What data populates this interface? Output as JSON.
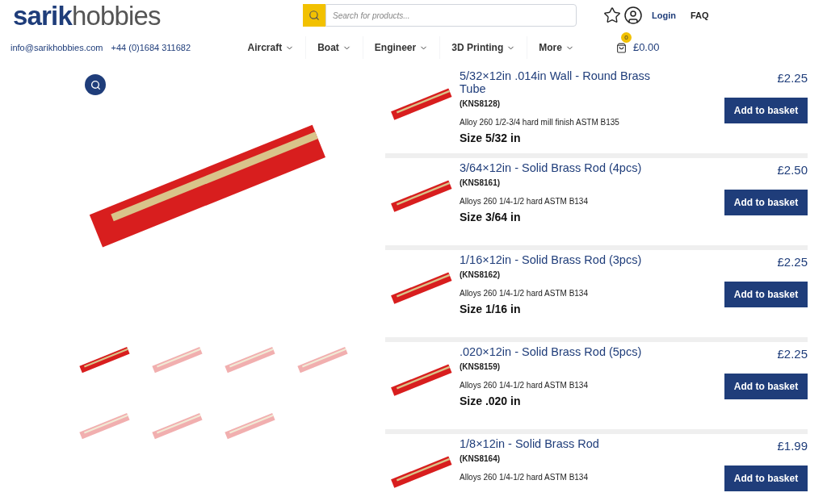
{
  "logo": {
    "bold": "sarik",
    "light": "hobbies"
  },
  "contact": {
    "email": "info@sarikhobbies.com",
    "phone": "+44 (0)1684 311682"
  },
  "search": {
    "placeholder": "Search for products..."
  },
  "account": {
    "login": "Login",
    "faq": "FAQ"
  },
  "nav": [
    {
      "label": "Aircraft"
    },
    {
      "label": "Boat"
    },
    {
      "label": "Engineer"
    },
    {
      "label": "3D Printing"
    },
    {
      "label": "More"
    }
  ],
  "cart": {
    "count": "0",
    "total": "£0.00"
  },
  "gallery": {
    "thumbnails": [
      {
        "selected": true
      },
      {
        "selected": false
      },
      {
        "selected": false
      },
      {
        "selected": false
      },
      {
        "selected": false
      },
      {
        "selected": false
      },
      {
        "selected": false
      }
    ]
  },
  "products": [
    {
      "title": "5/32×12in .014in Wall - Round Brass Tube",
      "code": "(KNS8128)",
      "spec": "Alloy 260 1/2-3/4 hard mill finish ASTM B135",
      "size": "Size 5/32 in",
      "price": "£2.25",
      "button": "Add to basket"
    },
    {
      "title": "3/64×12in - Solid Brass Rod (4pcs)",
      "code": "(KNS8161)",
      "spec": "Alloys 260 1/4-1/2 hard ASTM B134",
      "size": "Size 3/64 in",
      "price": "£2.50",
      "button": "Add to basket"
    },
    {
      "title": "1/16×12in - Solid Brass Rod (3pcs)",
      "code": "(KNS8162)",
      "spec": "Alloys 260 1/4-1/2 hard ASTM B134",
      "size": "Size 1/16 in",
      "price": "£2.25",
      "button": "Add to basket"
    },
    {
      "title": ".020×12in - Solid Brass Rod (5pcs)",
      "code": "(KNS8159)",
      "spec": "Alloys 260 1/4-1/2 hard ASTM B134",
      "size": "Size .020 in",
      "price": "£2.25",
      "button": "Add to basket"
    },
    {
      "title": "1/8×12in - Solid Brass Rod",
      "code": "(KNS8164)",
      "spec": "Alloys 260 1/4-1/2 hard ASTM B134",
      "price": "£1.99",
      "button": "Add to basket"
    }
  ]
}
